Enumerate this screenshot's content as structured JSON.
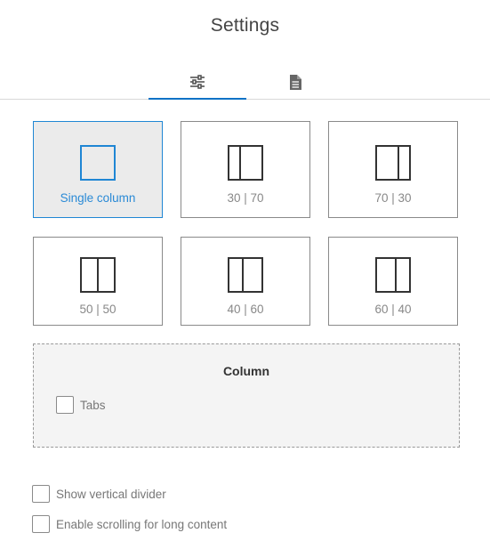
{
  "header": {
    "title": "Settings"
  },
  "tabs": [
    {
      "id": "layout",
      "icon": "sliders-icon",
      "active": true
    },
    {
      "id": "content",
      "icon": "document-icon",
      "active": false
    }
  ],
  "layouts": [
    {
      "label": "Single column",
      "icon": "single-column-icon",
      "selected": true
    },
    {
      "label": "30 | 70",
      "icon": "two-column-30-70-icon",
      "selected": false
    },
    {
      "label": "70 | 30",
      "icon": "two-column-70-30-icon",
      "selected": false
    },
    {
      "label": "50 | 50",
      "icon": "two-column-50-50-icon",
      "selected": false
    },
    {
      "label": "40 | 60",
      "icon": "two-column-40-60-icon",
      "selected": false
    },
    {
      "label": "60 | 40",
      "icon": "two-column-60-40-icon",
      "selected": false
    }
  ],
  "column_section": {
    "title": "Column",
    "tabs_option": {
      "label": "Tabs",
      "checked": false
    }
  },
  "options": [
    {
      "label": "Show vertical divider",
      "checked": false
    },
    {
      "label": "Enable scrolling for long content",
      "checked": false
    }
  ],
  "colors": {
    "accent": "#1f86d4",
    "tab_underline": "#0c72c6",
    "selected_card_bg": "#ebebeb",
    "border": "#8a8a8a"
  }
}
